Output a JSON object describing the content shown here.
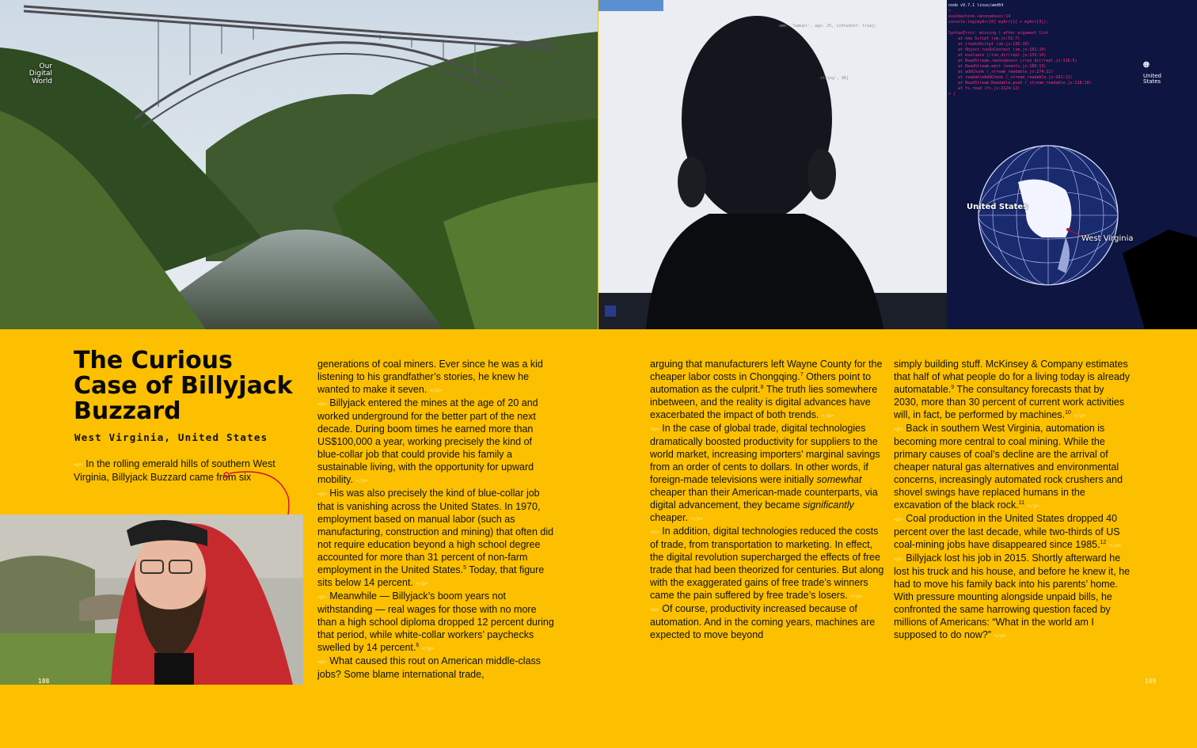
{
  "series": {
    "label": "Our\nDigital\nWorld"
  },
  "article": {
    "title": "The Curious Case of Billyjack Buzzard",
    "location": "West Virginia, United States",
    "intro": "In the rolling emerald hills of southern West Virginia, Billyjack Buzzard came from six"
  },
  "map": {
    "country": "United States",
    "state": "West Virginia",
    "corner": "United States"
  },
  "terminal": {
    "head": "node v9.7.1 linux/amd64",
    "lines": [
      ">",
      "evalmachine.<anonymous>:14",
      "console.log(myArr[0] myArr[1] + myArr[3]);",
      "",
      "SyntaxError: missing ) after argument list",
      "    at new Script (vm.js:51:7)",
      "    at createScript (vm.js:136:10)",
      "    at Object.runInContext (vm.js:181:10)",
      "    at evaluate (/run_dir/repl.js:133:14)",
      "    at ReadStream.<anonymous> (/run_dir/repl.js:116:5)",
      "    at ReadStream.emit (events.js:180:13)",
      "    at addChunk (_stream_readable.js:274:12)",
      "    at readableAddChunk (_stream_readable.js:261:11)",
      "    at ReadStream.Readable.push (_stream_readable.js:218:10)",
      "    at fs.read (fs.js:2124:12)",
      "> |"
    ],
    "code_fragment_1": "ame: 'Samuel', age: 25, isStudent: true};",
    "code_fragment_2": "string', 86]"
  },
  "tag": "</p>",
  "columns": {
    "c2": [
      {
        "parts": [
          "generations of coal miners. Ever since he was a kid listening to his grandfather’s stories, he knew he wanted to make it seven."
        ],
        "sup": []
      },
      {
        "parts": [
          "Billyjack entered the mines at the age of 20 and worked underground for the better part of the next decade. During boom times he earned more than US$100,000 a year, working precisely the kind of blue-collar job that could provide his family a sustainable living, with the opportunity for upward mobility."
        ],
        "sup": []
      },
      {
        "parts": [
          "His was also precisely the kind of blue-collar job that is vanishing across the United States. In 1970, employment based on manual labor (such as manufacturing, construction and mining) that often did not require education beyond a high school degree accounted for more than 31 percent of non-farm employment in the United States.",
          " Today, that figure sits below 14 percent."
        ],
        "sup": [
          "5"
        ]
      },
      {
        "parts": [
          "Meanwhile — Billyjack’s boom years not withstanding — real wages for those with no more than a high school diploma dropped 12 percent during that period, while white-collar workers’ paychecks swelled by 14 percent."
        ],
        "sup": [
          "6"
        ]
      },
      {
        "parts": [
          "What caused this rout on American middle-class jobs? Some blame international trade,"
        ],
        "sup": [],
        "open": true
      }
    ],
    "c3": [
      {
        "parts": [
          "arguing that manufacturers left Wayne County for the cheaper labor costs in Chongqing.",
          " Others point to automation as the culprit.",
          " The truth lies somewhere inbetween, and the reality is digital advances have exacerbated the impact of both trends."
        ],
        "sup": [
          "7",
          "8"
        ],
        "cont": true
      },
      {
        "parts": [
          "In the case of global trade, digital technologies dramatically boosted productivity for suppliers to the world market, increasing importers’ marginal savings from an order of cents to dollars. In other words, if foreign-made televisions were initially "
        ],
        "em1": "somewhat",
        "parts2": " cheaper than their American-made counterparts, via digital advancement, they became ",
        "em2": "significantly",
        "parts3": " cheaper."
      },
      {
        "parts": [
          "In addition, digital technologies reduced the costs of trade, from transportation to marketing. In effect, the digital revolution supercharged the effects of free trade that had been theorized for centuries. But along with the exaggerated gains of free trade’s winners came the pain suffered by free trade’s losers."
        ],
        "sup": []
      },
      {
        "parts": [
          "Of course, productivity increased because of automation. And in the coming years, machines are expected to move beyond"
        ],
        "sup": [],
        "open": true
      }
    ],
    "c4": [
      {
        "parts": [
          "simply building stuff. McKinsey & Company estimates that half of what people do for a living today is already automatable.",
          " The consultancy forecasts that by 2030, more than 30 percent of current work activities will, in fact, be performed by machines."
        ],
        "sup": [
          "9",
          "10"
        ],
        "cont": true
      },
      {
        "parts": [
          "Back in southern West Virginia, automation is becoming more central to coal mining. While the primary causes of coal’s decline are the arrival of cheaper natural gas alternatives and environmental concerns, increasingly automated rock crushers and shovel swings have replaced humans in the excavation of the black rock."
        ],
        "sup": [
          "11"
        ]
      },
      {
        "parts": [
          "Coal production in the United States dropped 40 percent over the last decade, while two-thirds of US coal-mining jobs have disappeared since 1985."
        ],
        "sup": [
          "12"
        ]
      },
      {
        "parts": [
          "Billyjack lost his job in 2015. Shortly afterward he lost his truck and his house, and before he knew it, he had to move his family back into his parents’ home. With pressure mounting alongside unpaid bills, he confronted the same harrowing question faced by millions of Americans: “What in the world am I supposed to do now?”"
        ],
        "sup": []
      }
    ]
  },
  "pages": {
    "left": "108",
    "right": "109"
  },
  "colors": {
    "background": "#fcc000",
    "annotation": "#d0103a"
  }
}
